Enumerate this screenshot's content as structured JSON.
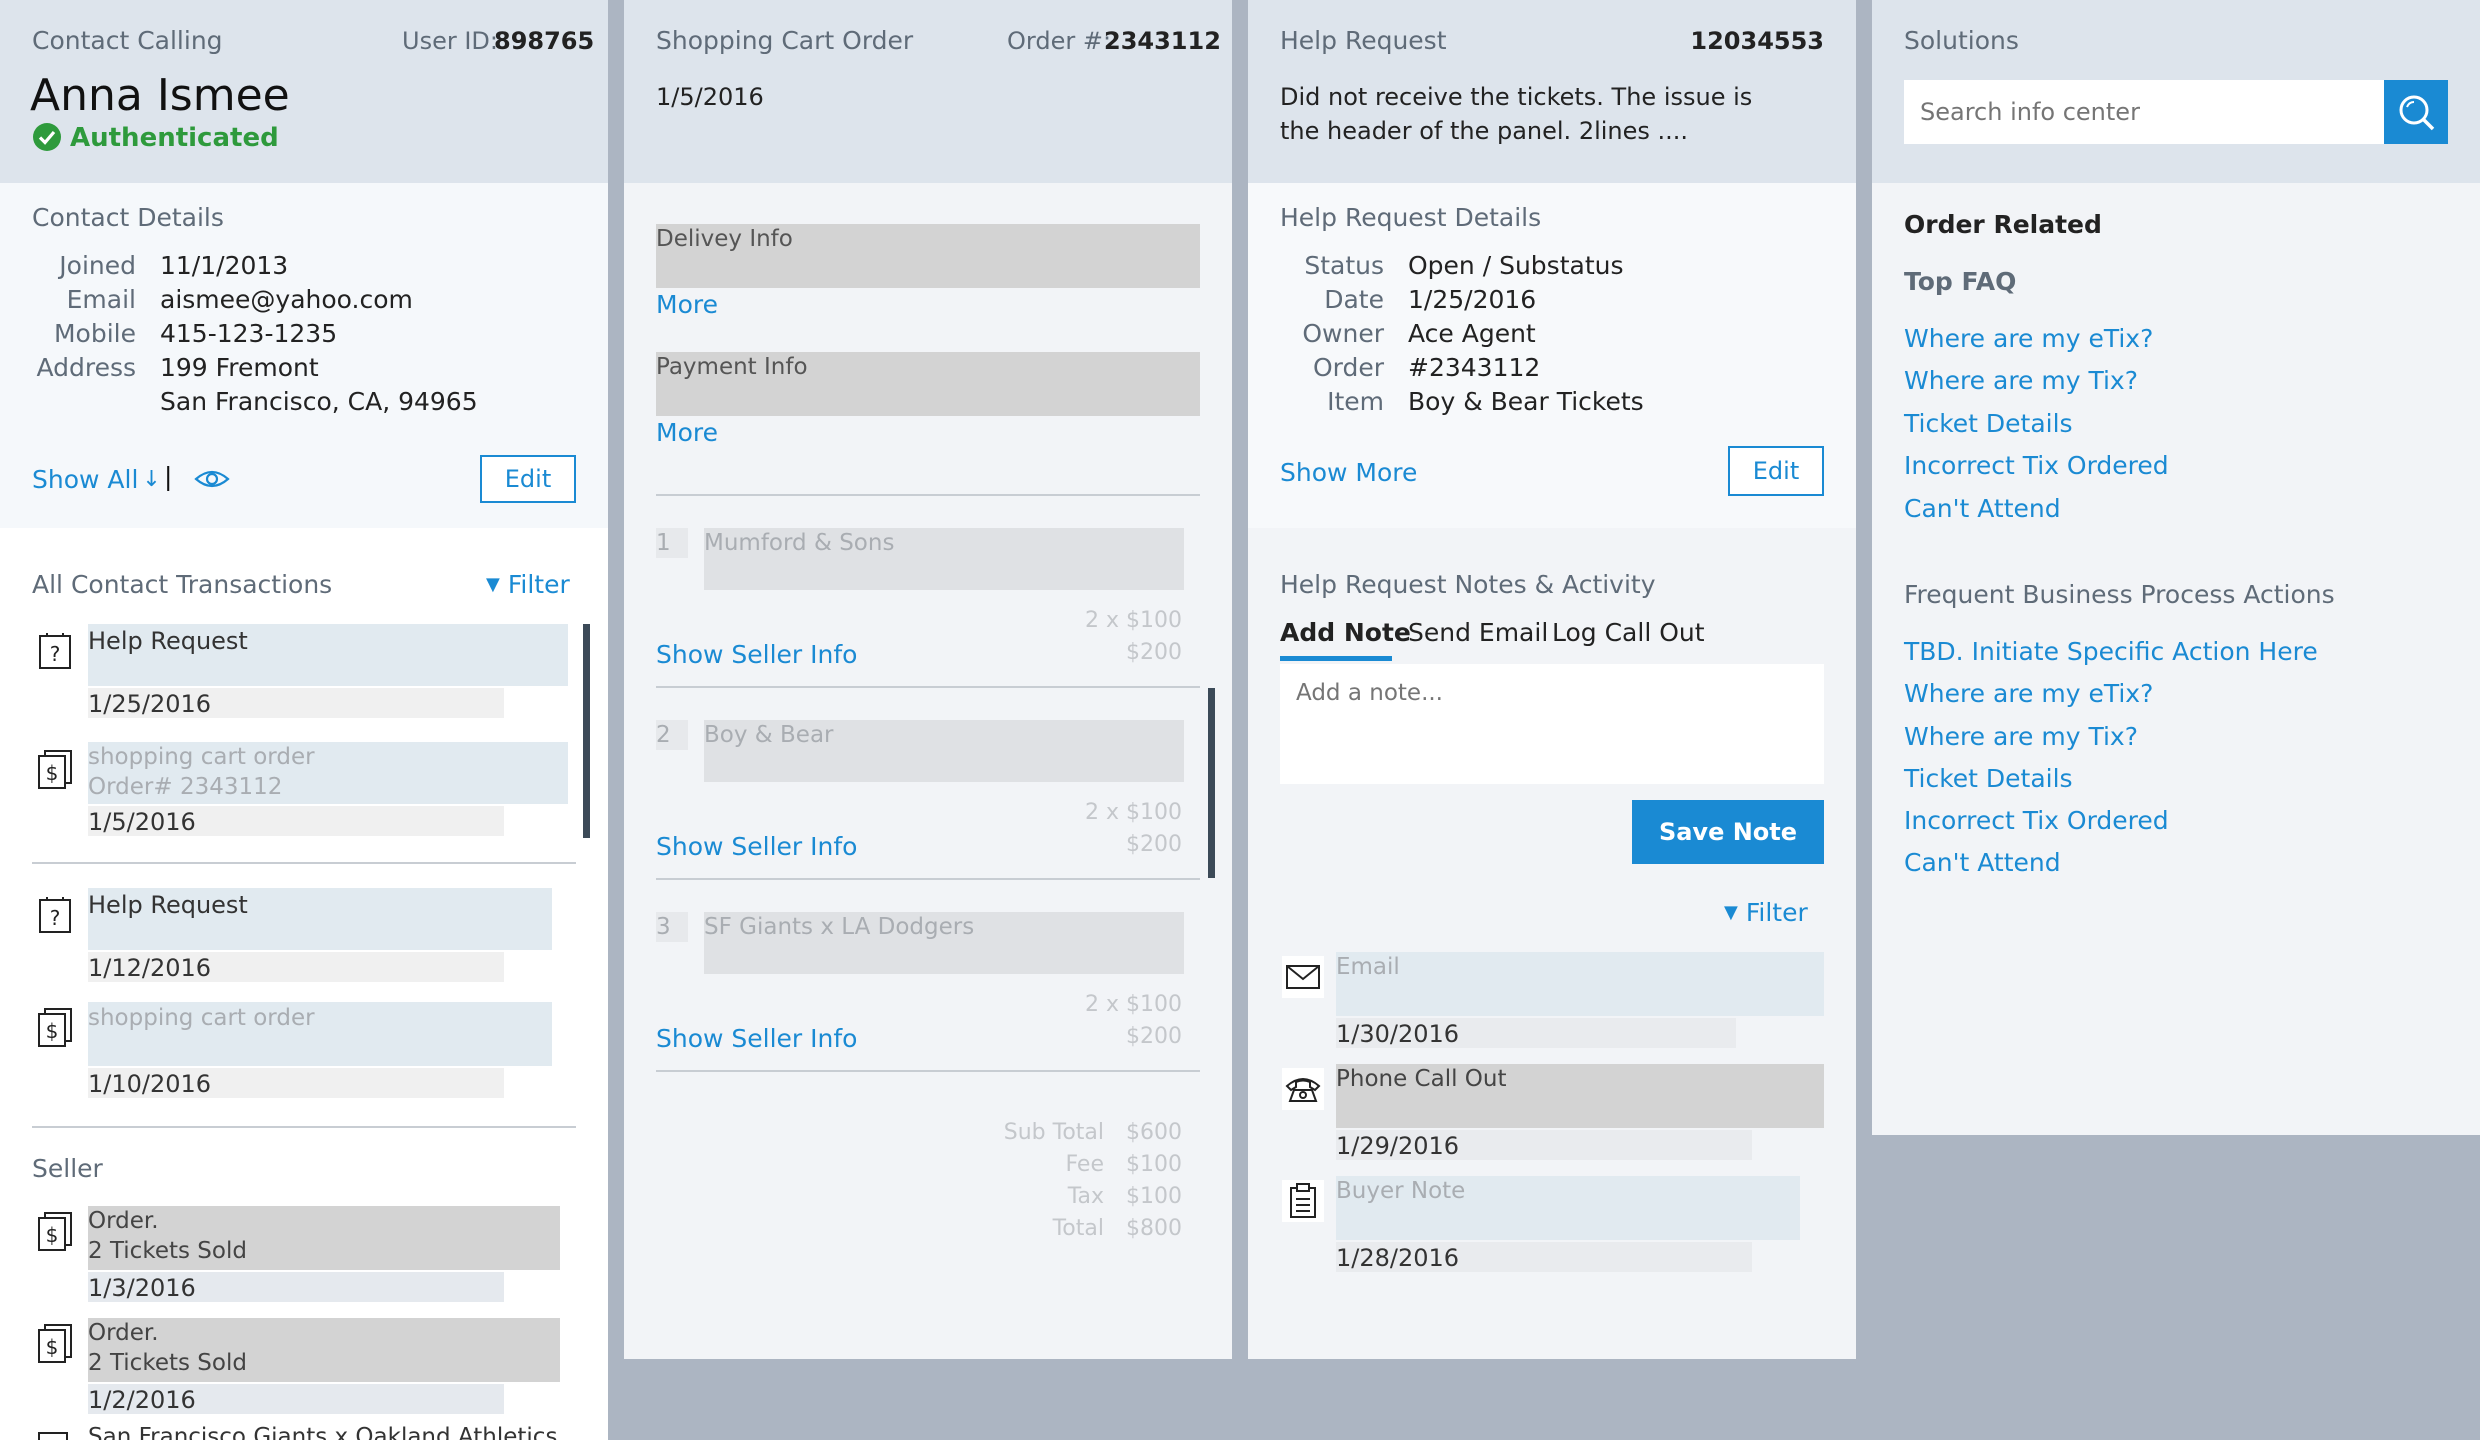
{
  "contact": {
    "panel_title": "Contact Calling",
    "user_id_label": "User ID:",
    "user_id": "898765",
    "name": "Anna Ismee",
    "auth_status": "Authenticated",
    "details_title": "Contact Details",
    "details": [
      {
        "label": "Joined",
        "value": "11/1/2013"
      },
      {
        "label": "Email",
        "value": "aismee@yahoo.com"
      },
      {
        "label": "Mobile",
        "value": "415-123-1235"
      },
      {
        "label": "Address",
        "value": "199 Fremont"
      }
    ],
    "address_line2": "San Francisco, CA, 94965",
    "show_all": "Show All",
    "separator": "|",
    "edit_label": "Edit",
    "transactions_title": "All Contact Transactions",
    "filter_label": "Filter",
    "transactions": [
      {
        "title": "Help Request",
        "date": "1/25/2016"
      },
      {
        "title": "shopping cart order",
        "subtitle": "Order# 2343112",
        "date": "1/5/2016"
      },
      {
        "title": "Help Request",
        "date": "1/12/2016"
      },
      {
        "title": "shopping cart order",
        "date": "1/10/2016"
      }
    ],
    "seller_title": "Seller",
    "seller_items": [
      {
        "line1": "Order.",
        "line2": "2 Tickets Sold",
        "date": "1/3/2016"
      },
      {
        "line1": "Order.",
        "line2": "2 Tickets Sold",
        "date": "1/2/2016"
      }
    ],
    "seller_cutoff": "San Francisco Giants x Oakland Athletics"
  },
  "cart": {
    "panel_title": "Shopping Cart Order",
    "order_label": "Order #:",
    "order_number": "2343112",
    "date": "1/5/2016",
    "delivery_label": "Delivey Info",
    "payment_label": "Payment Info",
    "more_label": "More",
    "items": [
      {
        "num": "1",
        "name": "Mumford & Sons",
        "qty": "2 x $100",
        "price": "$200"
      },
      {
        "num": "2",
        "name": "Boy & Bear",
        "qty": "2 x $100",
        "price": "$200"
      },
      {
        "num": "3",
        "name": "SF Giants x LA Dodgers",
        "qty": "2 x $100",
        "price": "$200"
      }
    ],
    "show_seller": "Show Seller Info",
    "totals": [
      {
        "label": "Sub Total",
        "value": "$600"
      },
      {
        "label": "Fee",
        "value": "$100"
      },
      {
        "label": "Tax",
        "value": "$100"
      },
      {
        "label": "Total",
        "value": "$800"
      }
    ]
  },
  "help": {
    "panel_title": "Help Request",
    "request_id": "12034553",
    "description_line1": "Did not receive the tickets. The issue is",
    "description_line2": "the header of the panel. 2lines ....",
    "details_title": "Help Request Details",
    "details": [
      {
        "label": "Status",
        "value": "Open / Substatus"
      },
      {
        "label": "Date",
        "value": "1/25/2016"
      },
      {
        "label": "Owner",
        "value": "Ace Agent"
      },
      {
        "label": "Order",
        "value": "#2343112"
      },
      {
        "label": "Item",
        "value": "Boy & Bear Tickets"
      }
    ],
    "show_more": "Show More",
    "edit_label": "Edit",
    "notes_title": "Help Request Notes & Activity",
    "tabs": [
      "Add Note",
      "Send Email",
      "Log Call Out"
    ],
    "note_placeholder": "Add a note...",
    "save_note": "Save Note",
    "filter_label": "Filter",
    "activity": [
      {
        "type": "Email",
        "date": "1/30/2016"
      },
      {
        "type": "Phone Call Out",
        "date": "1/29/2016"
      },
      {
        "type": "Buyer Note",
        "date": "1/28/2016"
      }
    ]
  },
  "solutions": {
    "panel_title": "Solutions",
    "search_placeholder": "Search info center",
    "order_related": "Order Related",
    "top_faq": "Top FAQ",
    "faq_links": [
      "Where are my eTix?",
      "Where are my Tix?",
      "Ticket Details",
      "Incorrect Tix Ordered",
      "Can't Attend"
    ],
    "frequent_title": "Frequent Business Process Actions",
    "action_links": [
      "TBD. Initiate Specific Action Here",
      "Where are my eTix?",
      "Where are my Tix?",
      "Ticket Details",
      "Incorrect Tix Ordered",
      "Can't Attend"
    ]
  },
  "colors": {
    "accent": "#1a8ad3",
    "success": "#2e9a3c",
    "header_bg": "#dde4ec",
    "page_bg": "#acb5c2"
  }
}
